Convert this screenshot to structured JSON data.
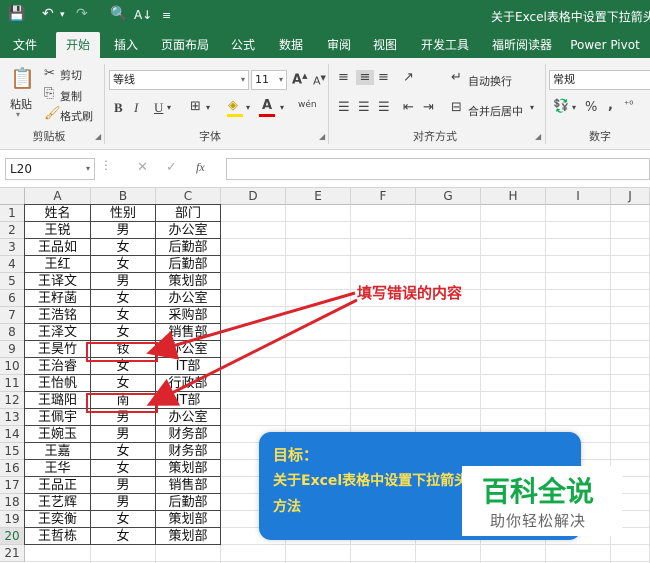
{
  "titlebar": {
    "title": "关于Excel表格中设置下拉箭头的方",
    "icons": [
      "save-icon",
      "undo-icon",
      "redo-icon",
      "print-preview-icon",
      "sort-icon",
      "customize-icon"
    ]
  },
  "tabs": [
    {
      "label": "文件"
    },
    {
      "label": "开始"
    },
    {
      "label": "插入"
    },
    {
      "label": "页面布局"
    },
    {
      "label": "公式"
    },
    {
      "label": "数据"
    },
    {
      "label": "审阅"
    },
    {
      "label": "视图"
    },
    {
      "label": "开发工具"
    },
    {
      "label": "福昕阅读器"
    },
    {
      "label": "Power Pivot"
    }
  ],
  "ribbon": {
    "clipboard": {
      "paste": "粘贴",
      "cut": "剪切",
      "copy": "复制",
      "format_painter": "格式刷",
      "group": "剪贴板"
    },
    "font": {
      "name": "等线",
      "size": "11",
      "bold": "B",
      "italic": "I",
      "underline": "U",
      "grow": "A",
      "shrink": "A",
      "phonetic": "wén",
      "group": "字体"
    },
    "alignment": {
      "wrap": "自动换行",
      "merge": "合并后居中",
      "group": "对齐方式"
    },
    "number": {
      "format": "常规",
      "percent": "%",
      "comma": ",",
      "group": "数字"
    }
  },
  "formula_bar": {
    "name_box": "L20",
    "cancel": "✕",
    "enter": "✓",
    "fx": "fx",
    "value": ""
  },
  "grid": {
    "columns": [
      "A",
      "B",
      "C",
      "D",
      "E",
      "F",
      "G",
      "H",
      "I",
      "J"
    ],
    "rows": [
      "1",
      "2",
      "3",
      "4",
      "5",
      "6",
      "7",
      "8",
      "9",
      "10",
      "11",
      "12",
      "13",
      "14",
      "15",
      "16",
      "17",
      "18",
      "19",
      "20",
      "21"
    ],
    "selected_row": "20",
    "table": [
      [
        "姓名",
        "性别",
        "部门"
      ],
      [
        "王锐",
        "男",
        "办公室"
      ],
      [
        "王品如",
        "女",
        "后勤部"
      ],
      [
        "王红",
        "女",
        "后勤部"
      ],
      [
        "王译文",
        "男",
        "策划部"
      ],
      [
        "王籽菡",
        "女",
        "办公室"
      ],
      [
        "王浩铭",
        "女",
        "采购部"
      ],
      [
        "王泽文",
        "女",
        "销售部"
      ],
      [
        "王昊竹",
        "钕",
        "办公室"
      ],
      [
        "王治睿",
        "女",
        "IT部"
      ],
      [
        "王怡帆",
        "女",
        "行政部"
      ],
      [
        "王璐阳",
        "南",
        "IT部"
      ],
      [
        "王佩宇",
        "男",
        "办公室"
      ],
      [
        "王婉玉",
        "男",
        "财务部"
      ],
      [
        "王嘉",
        "女",
        "财务部"
      ],
      [
        "王华",
        "女",
        "策划部"
      ],
      [
        "王品正",
        "男",
        "销售部"
      ],
      [
        "王艺辉",
        "男",
        "后勤部"
      ],
      [
        "王奕衡",
        "女",
        "策划部"
      ],
      [
        "王哲栋",
        "女",
        "策划部"
      ]
    ]
  },
  "annotation": "填写错误的内容",
  "goal_panel": {
    "label": "目标：",
    "line1": "关于Excel表格中设置下拉箭头的",
    "line2": "方法"
  },
  "watermark": {
    "big": "百科全说",
    "small": "助你轻松解决"
  },
  "colors": {
    "excel_green": "#217346",
    "annotation_red": "#d9252b",
    "panel_blue": "#1e7cd8",
    "panel_text": "#ffe14d",
    "watermark_green": "#14a84a"
  }
}
